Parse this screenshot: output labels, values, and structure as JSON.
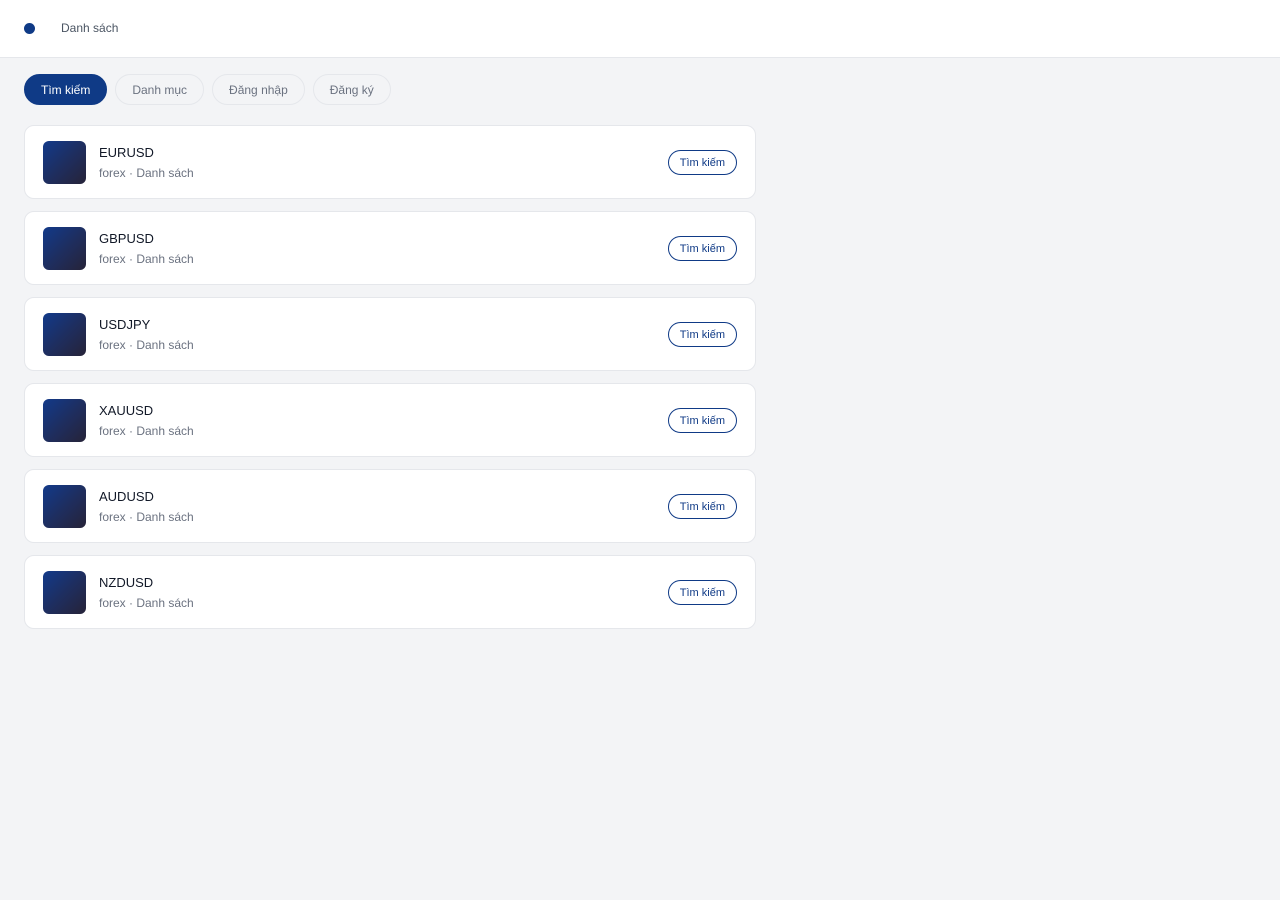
{
  "header": {
    "nav_link": "Danh sách",
    "accent_color": "#0f3a86"
  },
  "tabs": [
    {
      "label": "Tìm kiếm",
      "active": true
    },
    {
      "label": "Danh mục",
      "active": false
    },
    {
      "label": "Đăng nhập",
      "active": false
    },
    {
      "label": "Đăng ký",
      "active": false
    }
  ],
  "items": [
    {
      "title": "EURUSD",
      "subtitle": "forex · Danh sách",
      "action": "Tìm kiếm"
    },
    {
      "title": "GBPUSD",
      "subtitle": "forex · Danh sách",
      "action": "Tìm kiếm"
    },
    {
      "title": "USDJPY",
      "subtitle": "forex · Danh sách",
      "action": "Tìm kiếm"
    },
    {
      "title": "XAUUSD",
      "subtitle": "forex · Danh sách",
      "action": "Tìm kiếm"
    },
    {
      "title": "AUDUSD",
      "subtitle": "forex · Danh sách",
      "action": "Tìm kiếm"
    },
    {
      "title": "NZDUSD",
      "subtitle": "forex · Danh sách",
      "action": "Tìm kiếm"
    }
  ]
}
